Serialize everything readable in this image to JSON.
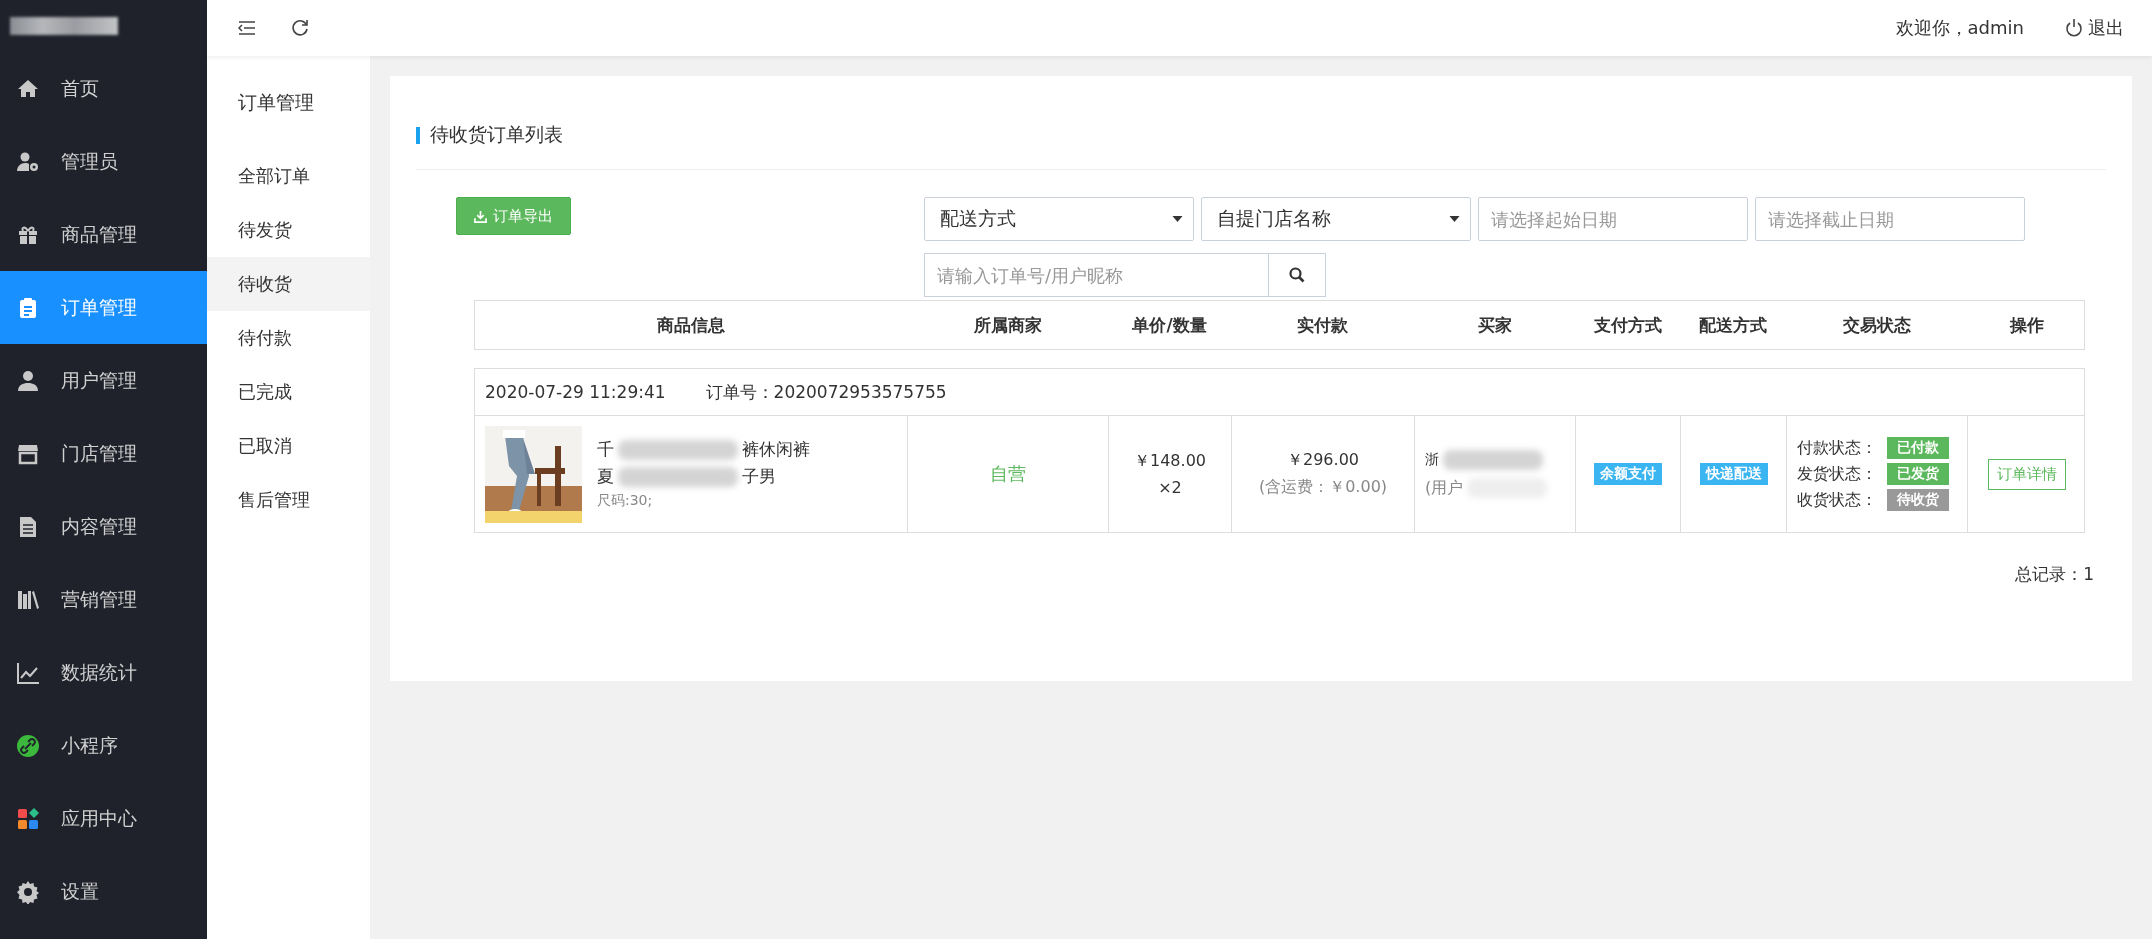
{
  "sidebar": {
    "items": [
      {
        "label": "首页",
        "selected": false
      },
      {
        "label": "管理员",
        "selected": false
      },
      {
        "label": "商品管理",
        "selected": false
      },
      {
        "label": "订单管理",
        "selected": true
      },
      {
        "label": "用户管理",
        "selected": false
      },
      {
        "label": "门店管理",
        "selected": false
      },
      {
        "label": "内容管理",
        "selected": false
      },
      {
        "label": "营销管理",
        "selected": false
      },
      {
        "label": "数据统计",
        "selected": false
      },
      {
        "label": "小程序",
        "selected": false
      },
      {
        "label": "应用中心",
        "selected": false
      },
      {
        "label": "设置",
        "selected": false
      }
    ]
  },
  "header": {
    "welcome": "欢迎你，admin",
    "logout": "退出"
  },
  "subnav": {
    "title": "订单管理",
    "items": [
      {
        "label": "全部订单",
        "selected": false
      },
      {
        "label": "待发货",
        "selected": false
      },
      {
        "label": "待收货",
        "selected": true
      },
      {
        "label": "待付款",
        "selected": false
      },
      {
        "label": "已完成",
        "selected": false
      },
      {
        "label": "已取消",
        "selected": false
      },
      {
        "label": "售后管理",
        "selected": false
      }
    ]
  },
  "panel": {
    "title": "待收货订单列表",
    "export_button": "订单导出",
    "filters": {
      "delivery_select": "配送方式",
      "store_select": "自提门店名称",
      "start_date_placeholder": "请选择起始日期",
      "end_date_placeholder": "请选择截止日期",
      "search_placeholder": "请输入订单号/用户昵称"
    }
  },
  "table": {
    "columns": [
      "商品信息",
      "所属商家",
      "单价/数量",
      "实付款",
      "买家",
      "支付方式",
      "配送方式",
      "交易状态",
      "操作"
    ],
    "orders": [
      {
        "time": "2020-07-29 11:29:41",
        "order_no": "订单号：2020072953575755",
        "product": {
          "line1_start": "千",
          "line1_end": "裤休闲裤",
          "line2_start": "夏",
          "line2_end": "子男",
          "spec": "尺码:30;"
        },
        "merchant": "自营",
        "unit_price": "￥148.00",
        "quantity": "×2",
        "paid": "￥296.00",
        "shipping": "(含运费：￥0.00)",
        "buyer_name": "浙",
        "buyer_id": "(用户",
        "payment_method": "余额支付",
        "delivery_method": "快递配送",
        "statuses": [
          {
            "label": "付款状态：",
            "value": "已付款",
            "color": "#5cb85c"
          },
          {
            "label": "发货状态：",
            "value": "已发货",
            "color": "#5cb85c"
          },
          {
            "label": "收货状态：",
            "value": "待收货",
            "color": "#999999"
          }
        ],
        "action": "订单详情"
      }
    ]
  },
  "total": "总记录：1"
}
